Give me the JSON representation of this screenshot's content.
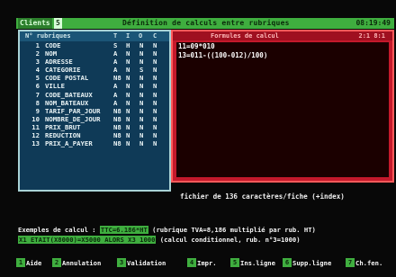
{
  "title_bar": {
    "app_tab": "Clients",
    "app_tab_suffix": "5",
    "screen_title": "Définition de calculs entre rubriques",
    "clock": "08:19:49"
  },
  "rubriques": {
    "header": {
      "no": "N° rubriques",
      "t": "T",
      "i": "I",
      "o": "O",
      "c": "C"
    },
    "rows": [
      {
        "num": "1",
        "name": "CODE",
        "c1": "S",
        "c2": "H",
        "c3": "N",
        "c4": "N"
      },
      {
        "num": "2",
        "name": "NOM",
        "c1": "A",
        "c2": "N",
        "c3": "N",
        "c4": "N"
      },
      {
        "num": "3",
        "name": "ADRESSE",
        "c1": "A",
        "c2": "N",
        "c3": "N",
        "c4": "N"
      },
      {
        "num": "4",
        "name": "CATEGORIE",
        "c1": "A",
        "c2": "N",
        "c3": "S",
        "c4": "N"
      },
      {
        "num": "5",
        "name": "CODE POSTAL",
        "c1": "N8",
        "c2": "N",
        "c3": "N",
        "c4": "N"
      },
      {
        "num": "6",
        "name": "VILLE",
        "c1": "A",
        "c2": "N",
        "c3": "N",
        "c4": "N"
      },
      {
        "num": "7",
        "name": "CODE_BATEAUX",
        "c1": "A",
        "c2": "N",
        "c3": "N",
        "c4": "N"
      },
      {
        "num": "8",
        "name": "NOM_BATEAUX",
        "c1": "A",
        "c2": "N",
        "c3": "N",
        "c4": "N"
      },
      {
        "num": "9",
        "name": "TARIF_PAR_JOUR",
        "c1": "N8",
        "c2": "N",
        "c3": "N",
        "c4": "N"
      },
      {
        "num": "10",
        "name": "NOMBRE_DE_JOUR",
        "c1": "N8",
        "c2": "N",
        "c3": "N",
        "c4": "N"
      },
      {
        "num": "11",
        "name": "PRIX_BRUT",
        "c1": "N8",
        "c2": "N",
        "c3": "N",
        "c4": "N"
      },
      {
        "num": "12",
        "name": "REDUCTION",
        "c1": "N8",
        "c2": "N",
        "c3": "N",
        "c4": "N"
      },
      {
        "num": "13",
        "name": "PRIX_A_PAYER",
        "c1": "N8",
        "c2": "N",
        "c3": "N",
        "c4": "N"
      }
    ]
  },
  "formules": {
    "title": "Formules de calcul",
    "counter": "2:1 8:1",
    "lines": [
      "11=09*010",
      "13=011-((100-012)/100)"
    ]
  },
  "fiche_info": "fichier de 136 caractères/fiche (+index)",
  "examples": {
    "label": "Exemples de calcul :",
    "ex1": "TTC=6.186*HT",
    "ex1_desc": "(rubrique TVA=8,186 multiplié par rub. HT)",
    "ex2": "X1 ETAIT(X8000)=X5000 ALORS X3 1000",
    "ex2_desc": "(calcul conditionnel, rub. n°3=1000)"
  },
  "function_keys": [
    {
      "key": "1",
      "label": "Aide"
    },
    {
      "key": "2",
      "label": "Annulation"
    },
    {
      "key": "3",
      "label": "Validation"
    },
    {
      "key": "4",
      "label": "Impr."
    },
    {
      "key": "5",
      "label": "Ins.ligne"
    },
    {
      "key": "6",
      "label": "Supp.ligne"
    },
    {
      "key": "7",
      "label": "Ch.fen."
    }
  ],
  "colors": {
    "green": "#3fae3f",
    "blue_panel": "#0f3a57",
    "red_panel": "#c4192b"
  }
}
